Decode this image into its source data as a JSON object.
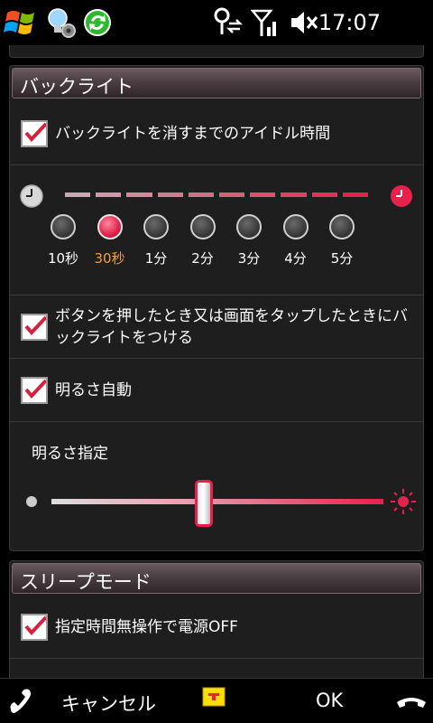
{
  "status_bar": {
    "time": "17:07",
    "icons": [
      "windows-start-icon",
      "bulb-icon",
      "sync-icon",
      "connectivity-icon",
      "signal-icon",
      "volume-muted-icon"
    ]
  },
  "backlight": {
    "header": "バックライト",
    "idle_checkbox": {
      "label": "バックライトを消すまでのアイドル時間",
      "checked": true
    },
    "timeout_options": [
      "10秒",
      "30秒",
      "1分",
      "2分",
      "3分",
      "4分",
      "5分"
    ],
    "timeout_selected": "30秒",
    "button_on_checkbox": {
      "label": "ボタンを押したとき又は画面をタップしたときにバックライトをつける",
      "checked": true
    },
    "auto_brightness_checkbox": {
      "label": "明るさ自動",
      "checked": true
    },
    "brightness_label": "明るさ指定",
    "brightness_level_percent": 46
  },
  "sleep_mode": {
    "header": "スリープモード",
    "power_off_checkbox": {
      "label": "指定時間無操作で電源OFF",
      "checked": true
    }
  },
  "bottom_bar": {
    "cancel_label": "キャンセル",
    "ok_label": "OK"
  },
  "colors": {
    "accent": "#e8204c",
    "check": "#d8203c"
  }
}
